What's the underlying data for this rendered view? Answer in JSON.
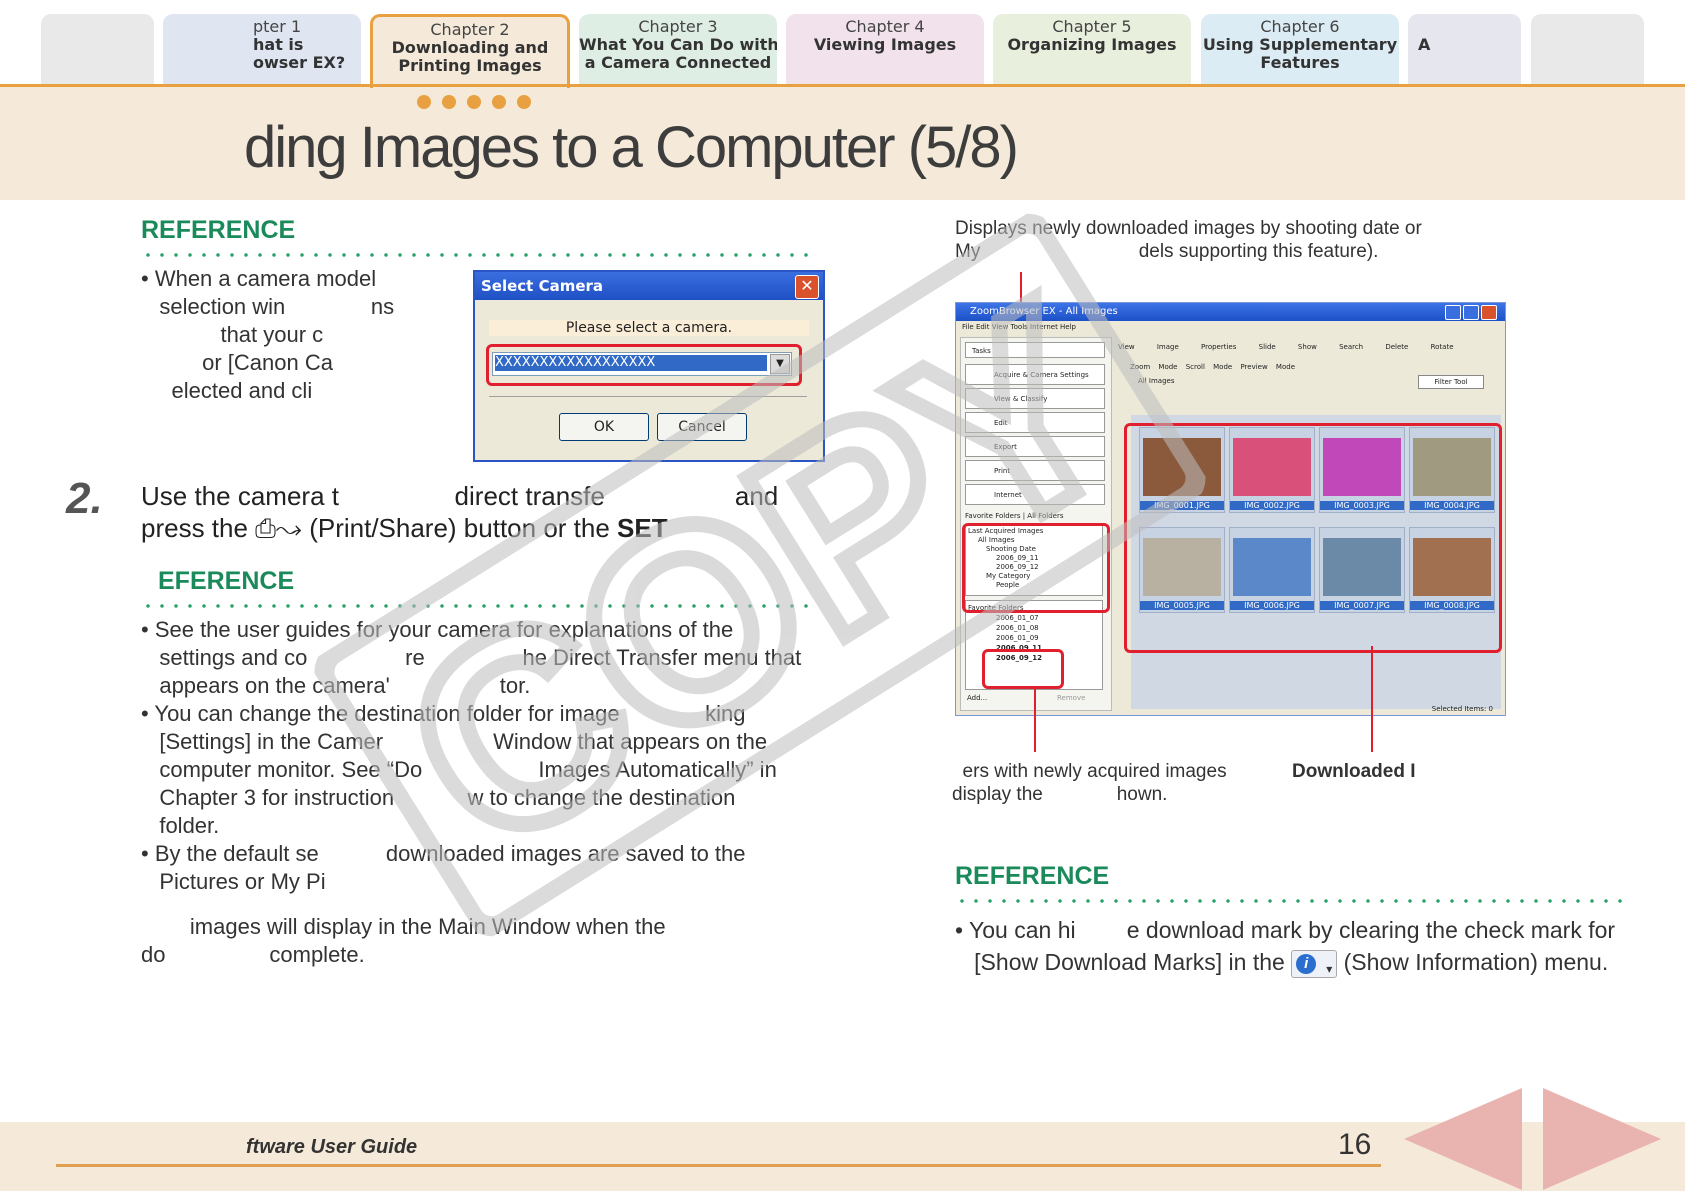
{
  "tabs": [
    {
      "chapter": "",
      "title": ""
    },
    {
      "chapter": "pter 1",
      "title": "hat is\nowser EX?"
    },
    {
      "chapter": "Chapter 2",
      "title": "Downloading and\nPrinting Images"
    },
    {
      "chapter": "Chapter 3",
      "title": "What You Can Do with\na Camera Connected"
    },
    {
      "chapter": "Chapter 4",
      "title": "Viewing Images"
    },
    {
      "chapter": "Chapter 5",
      "title": "Organizing Images"
    },
    {
      "chapter": "Chapter 6",
      "title": "Using Supplementary\nFeatures"
    },
    {
      "chapter": "",
      "title": "A"
    },
    {
      "chapter": "",
      "title": ""
    }
  ],
  "page_title": "ding Images to a Computer (5/8)",
  "reference_heading_1": "REFERENCE",
  "reference_1_text": "• When a camera model\n   selection win              ns\n             that your c\n          or [Canon Ca\n     elected and cli",
  "dialog": {
    "title": "Select Camera",
    "close": "✕",
    "prompt": "Please select a camera.",
    "selected": "XXXXXXXXXXXXXXXXXX",
    "ok": "OK",
    "cancel": "Cancel"
  },
  "step": {
    "number": "2.",
    "line1": "Use the camera t                direct transfe                  and",
    "line2_pre": "press the ",
    "line2_icon": "⎙↝",
    "line2_mid": " (Print/Share) button or the ",
    "line2_bold": "SET"
  },
  "reference_heading_2": "EFERENCE",
  "reference_2_items": [
    "• See the user guides for your camera for explanations of the\n   settings and co                re                he Direct Transfer menu that\n   appears on the camera'                  tor.",
    "• You can change the destination folder for image              king\n   [Settings] in the Camer                  Window that appears on the\n   computer monitor. See “Do                   Images Automatically” in\n   Chapter 3 for instruction            w to change the destination\n   folder.",
    "• By the default se           downloaded images are saved to the\n   Pictures or My Pi"
  ],
  "after_note": "        images will display in the Main Window when the\ndo                 complete.",
  "right_caption_top": "Displays newly downloaded images by shooting date or\nMy                              dels supporting this feature).",
  "right_caption_top_italic": "My",
  "zoombrowser": {
    "title": "ZoomBrowser EX - All Images",
    "menu": "File   Edit   View   Tools   Internet   Help",
    "tasks_label": "Tasks",
    "tasks": [
      "Acquire & Camera Settings",
      "View & Classify",
      "Edit",
      "Export",
      "Print",
      "Internet"
    ],
    "folder_tabs": [
      "Favorite Folders",
      "All Folders"
    ],
    "tree_header": "Last Acquired Images",
    "tree_items": [
      "All Images",
      "Shooting Date",
      "2006_09_11",
      "2006_09_12",
      "My Category",
      "People"
    ],
    "fav_header": "Favorite Folders",
    "folders": [
      "2006_01_07",
      "2006_01_08",
      "2006_01_09",
      "2006_09_11",
      "2006_09_12"
    ],
    "add_label": "Add...",
    "remove_label": "Remove",
    "toolbar": [
      "View Image",
      "Properties",
      "Slide Show",
      "Search",
      "Delete",
      "Rotate"
    ],
    "view_tabs": [
      "Zoom Mode",
      "Scroll Mode",
      "Preview Mode"
    ],
    "all_images_label": "All Images",
    "filter_label": "Filter Tool",
    "thumbs": [
      "IMG_0001.JPG",
      "IMG_0002.JPG",
      "IMG_0003.JPG",
      "IMG_0004.JPG",
      "IMG_0005.JPG",
      "IMG_0006.JPG",
      "IMG_0007.JPG",
      "IMG_0008.JPG"
    ],
    "thumb_colors": [
      "#8b5a3c",
      "#d9507a",
      "#c048b8",
      "#a09a80",
      "#b8b0a0",
      "#5a88c8",
      "#6a8aa8",
      "#a07050"
    ],
    "status": "Selected Items: 0"
  },
  "caption_bottom_left": "  ers with newly acquired images\ndisplay the              hown.",
  "caption_bottom_right": "Downloaded I",
  "reference_heading_3": "REFERENCE",
  "reference_3_line1": "• You can hi        e download mark by clearing the check mark for",
  "reference_3_line2_pre": "   [Show Download Marks] in the ",
  "reference_3_line2_post": " (Show Information) menu.",
  "watermark_text": "COPY",
  "footer_guide": "ftware User Guide",
  "page_number": "16",
  "colors": {
    "accent": "#e8a040",
    "reference_green": "#1a8a5a",
    "highlight_red": "#e0202f",
    "band": "#f5e9d9"
  }
}
